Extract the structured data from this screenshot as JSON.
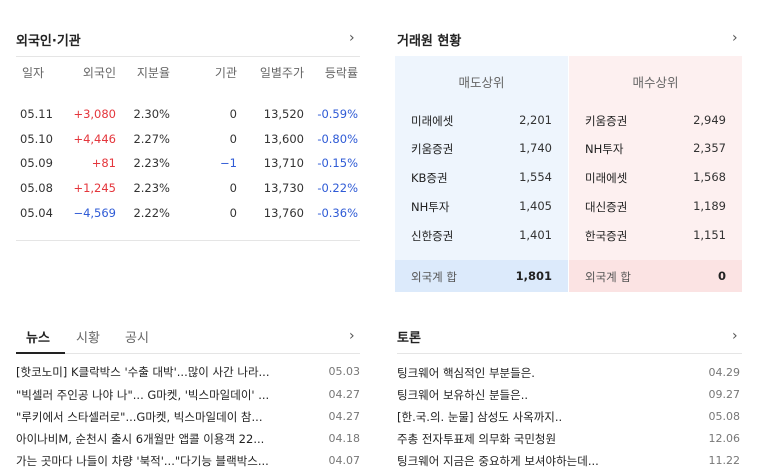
{
  "investor": {
    "title": "외국인·기관",
    "columns": [
      "일자",
      "외국인",
      "지분율",
      "기관",
      "일별주가",
      "등락률"
    ],
    "rows": [
      {
        "date": "05.11",
        "foreign": "+3,080",
        "share": "2.30%",
        "inst": "0",
        "price": "13,520",
        "change": "-0.59%"
      },
      {
        "date": "05.10",
        "foreign": "+4,446",
        "share": "2.27%",
        "inst": "0",
        "price": "13,600",
        "change": "-0.80%"
      },
      {
        "date": "05.09",
        "foreign": "+81",
        "share": "2.23%",
        "inst": "−1",
        "price": "13,710",
        "change": "-0.15%"
      },
      {
        "date": "05.08",
        "foreign": "+1,245",
        "share": "2.23%",
        "inst": "0",
        "price": "13,730",
        "change": "-0.22%"
      },
      {
        "date": "05.04",
        "foreign": "−4,569",
        "share": "2.22%",
        "inst": "0",
        "price": "13,760",
        "change": "-0.36%"
      }
    ],
    "colors": {
      "up": "#e4363c",
      "down": "#2f5bd6"
    }
  },
  "broker": {
    "title": "거래원 현황",
    "sell_title": "매도상위",
    "buy_title": "매수상위",
    "sell": [
      {
        "name": "미래에셋",
        "value": "2,201"
      },
      {
        "name": "키움증권",
        "value": "1,740"
      },
      {
        "name": "KB증권",
        "value": "1,554"
      },
      {
        "name": "NH투자",
        "value": "1,405"
      },
      {
        "name": "신한증권",
        "value": "1,401"
      }
    ],
    "buy": [
      {
        "name": "키움증권",
        "value": "2,949"
      },
      {
        "name": "NH투자",
        "value": "2,357"
      },
      {
        "name": "미래에셋",
        "value": "1,568"
      },
      {
        "name": "대신증권",
        "value": "1,189"
      },
      {
        "name": "한국증권",
        "value": "1,151"
      }
    ],
    "sell_foot_label": "외국계 합",
    "sell_foot_value": "1,801",
    "buy_foot_label": "외국계 합",
    "buy_foot_value": "0",
    "colors": {
      "sell_bg": "#eef5fd",
      "buy_bg": "#fdf0f0"
    }
  },
  "news": {
    "tabs": [
      "뉴스",
      "시황",
      "공시"
    ],
    "items": [
      {
        "title": "[핫코노미] K클락박스 '수출 대박'...많이 사간 나라...",
        "date": "05.03"
      },
      {
        "title": "\"빅셀러 주인공 나야 나\"... G마켓, '빅스마일데이' ...",
        "date": "04.27"
      },
      {
        "title": "\"루키에서 스타셀러로\"...G마켓, 빅스마일데이 참...",
        "date": "04.27"
      },
      {
        "title": "아이나비M, 순천시 출시 6개월만 앱콜 이용객 22...",
        "date": "04.18"
      },
      {
        "title": "가는 곳마다 나들이 차량 '북적'...\"다기능 블랙박스...",
        "date": "04.07"
      }
    ]
  },
  "forum": {
    "title": "토론",
    "items": [
      {
        "title": "팅크웨어 핵심적인 부분들은.",
        "date": "04.29"
      },
      {
        "title": "팅크웨어 보유하신 분들은..",
        "date": "09.27"
      },
      {
        "title": "[한.국.의. 눈물] 삼성도 사옥까지..",
        "date": "05.08"
      },
      {
        "title": "주총 전자투표제 의무화 국민청원",
        "date": "12.06"
      },
      {
        "title": "팅크웨어 지금은 중요하게 보셔야하는데...",
        "date": "11.22"
      }
    ]
  },
  "icons": {
    "more": "chevron-right-icon"
  }
}
